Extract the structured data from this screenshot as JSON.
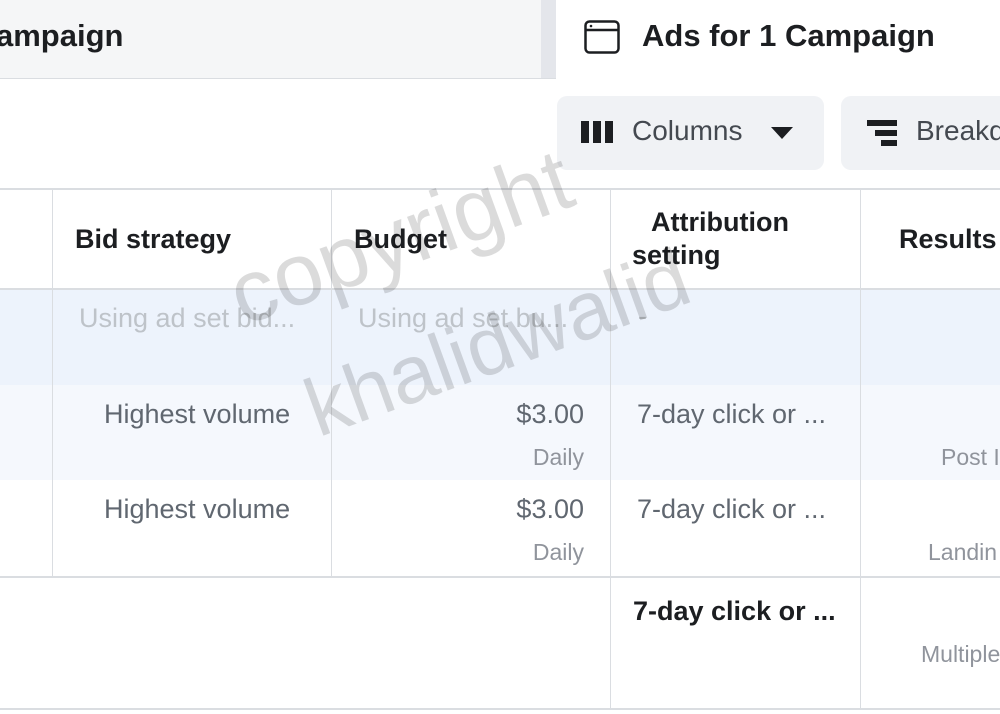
{
  "tabs": {
    "campaign_label": "ampaign",
    "ads_label": "Ads for 1 Campaign"
  },
  "toolbar": {
    "columns_label": "Columns",
    "breakdown_label": "Breakd"
  },
  "table": {
    "headers": {
      "bid_strategy": "Bid strategy",
      "budget": "Budget",
      "attribution_line1": "Attribution",
      "attribution_line2": "setting",
      "results": "Results"
    },
    "rows": [
      {
        "bid": "Using ad set bid...",
        "budget": "Using ad set bu...",
        "budget_sub": "",
        "attribution": "-",
        "results_sub": ""
      },
      {
        "bid": "Highest volume",
        "budget": "$3.00",
        "budget_sub": "Daily",
        "attribution": "7-day click or ...",
        "results_sub": "Post I"
      },
      {
        "bid": "Highest volume",
        "budget": "$3.00",
        "budget_sub": "Daily",
        "attribution": "7-day click or ...",
        "results_sub": "Landin"
      }
    ],
    "summary": {
      "attribution": "7-day click or ...",
      "results_sub": "Multiple"
    }
  },
  "watermark": {
    "line1": "copyright",
    "line2": "khalidwalid"
  },
  "colors": {
    "selected_row": "#edf3fc",
    "hover_row": "#f5f8fd",
    "tab_bg": "#f5f6f7",
    "button_bg": "#f0f2f5"
  }
}
